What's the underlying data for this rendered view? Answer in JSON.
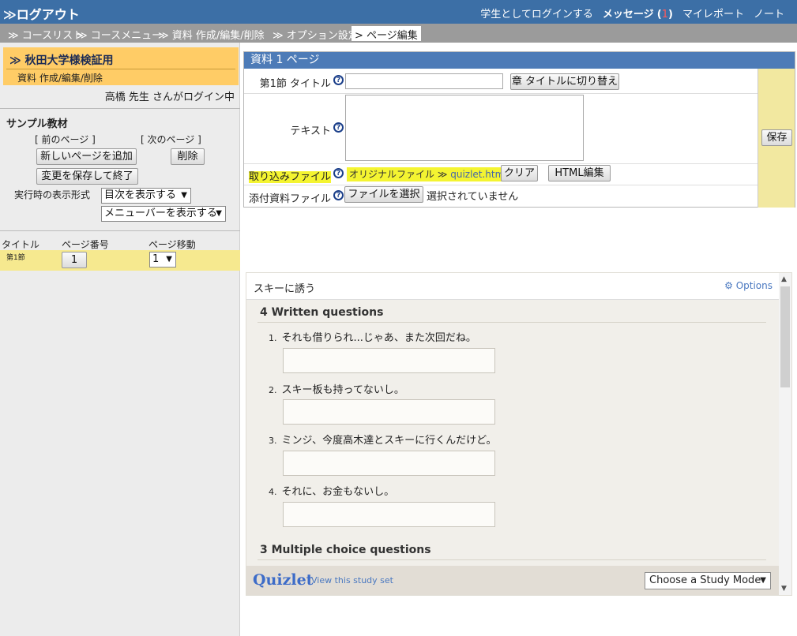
{
  "topbar": {
    "logout": "≫ログアウト",
    "student_login": "学生としてログインする",
    "messages_label": "メッセージ",
    "messages_open": "(",
    "messages_count": "1",
    "messages_close": ")",
    "my_report": "マイレポート",
    "note": "ノート"
  },
  "breadcrumb": {
    "items": [
      "≫ コースリスト",
      "≫ コースメニュー",
      "≫ 資料 作成/編集/削除",
      "≫ オプション設定"
    ],
    "current": "> ページ編集"
  },
  "sidebar": {
    "course_name": "≫ 秋田大学様検証用",
    "course_sub": "資料 作成/編集/削除",
    "login_user": "高橋 先生 さんがログイン中",
    "material_title": "サンプル教材",
    "prev_page": "[ 前のページ ]",
    "next_page": "[ 次のページ ]",
    "add_page": "新しいページを追加",
    "delete": "削除",
    "save_exit": "変更を保存して終了",
    "display_format_label": "実行時の表示形式",
    "toc_option": "目次を表示する",
    "menu_option": "メニューバーを表示する",
    "col_title": "タイトル",
    "col_page_no": "ページ番号",
    "col_move": "ページ移動",
    "row_title": "第1節",
    "row_page_no": "1",
    "row_move": "1"
  },
  "form": {
    "header": "資料 1 ページ",
    "section_title_label": "第1節 タイトル",
    "switch_button": "章 タイトルに切り替え",
    "text_label": "テキスト",
    "import_label": "取り込みファイル",
    "original_file": "オリジナルファイル ≫",
    "file_name": "quizlet.html",
    "clear": "クリア",
    "html_edit": "HTML編集",
    "attach_label": "添付資料ファイル",
    "choose_file": "ファイルを選択",
    "no_file": "選択されていません",
    "save": "保存",
    "help_glyph": "?"
  },
  "embed": {
    "title": "スキーに誘う",
    "options": "⚙ Options",
    "written_heading": "4 Written questions",
    "questions": [
      {
        "n": "1.",
        "text": "それも借りられ...じゃあ、また次回だね。"
      },
      {
        "n": "2.",
        "text": "スキー板も持ってないし。"
      },
      {
        "n": "3.",
        "text": "ミンジ、今度高木達とスキーに行くんだけど。"
      },
      {
        "n": "4.",
        "text": "それに、お金もないし。"
      }
    ],
    "mc_heading": "3 Multiple choice questions",
    "logo": "Quizlet",
    "view_link": "View this study set",
    "mode_select": "Choose a Study Mode"
  }
}
